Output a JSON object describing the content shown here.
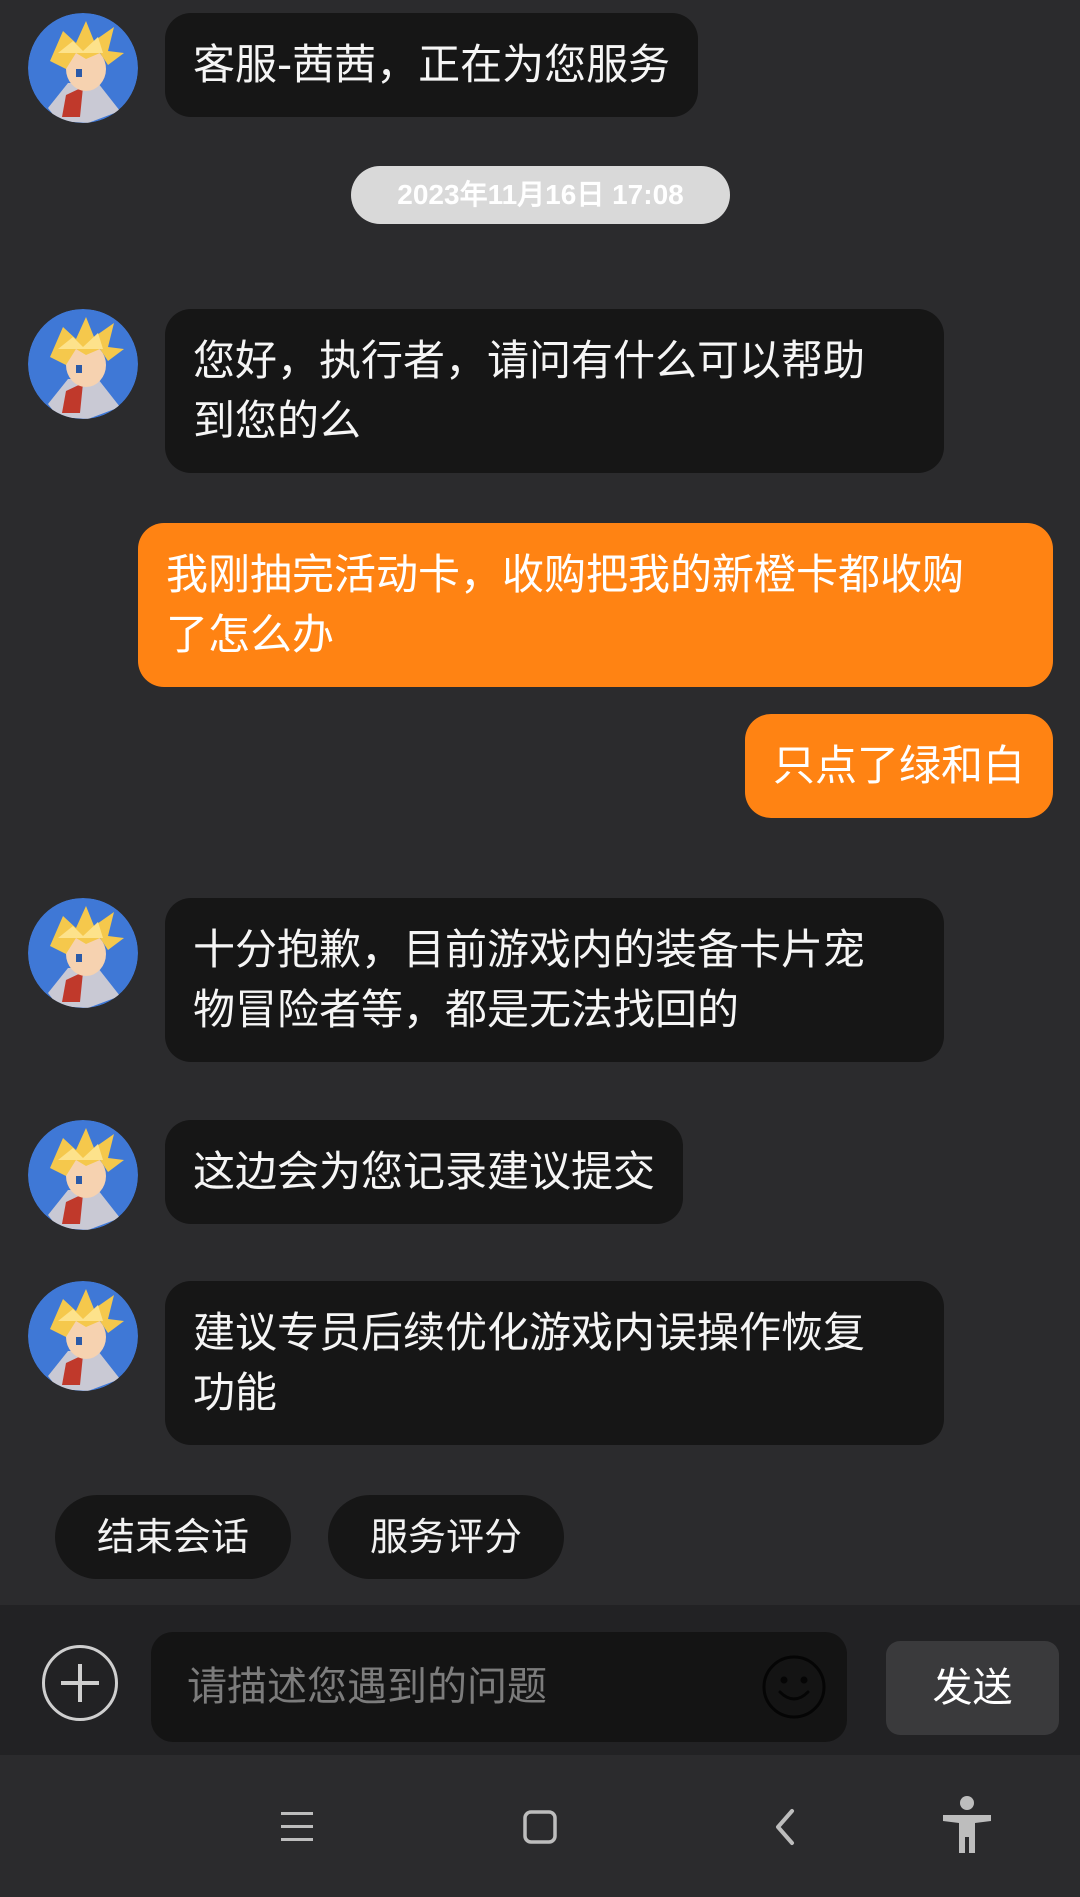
{
  "agent_name": "客服-茜茜",
  "timestamp": "2023年11月16日 17:08",
  "messages": [
    {
      "sender": "agent",
      "text": "客服-茜茜，正在为您服务"
    },
    {
      "sender": "agent",
      "text": "您好，执行者，请问有什么可以帮助\n到您的么"
    },
    {
      "sender": "user",
      "text": "我刚抽完活动卡，收购把我的新橙卡都收购\n了怎么办"
    },
    {
      "sender": "user",
      "text": "只点了绿和白"
    },
    {
      "sender": "agent",
      "text": "十分抱歉，目前游戏内的装备卡片宠\n物冒险者等，都是无法找回的"
    },
    {
      "sender": "agent",
      "text": "这边会为您记录建议提交"
    },
    {
      "sender": "agent",
      "text": "建议专员后续优化游戏内误操作恢复\n功能"
    }
  ],
  "quick_actions": [
    "结束会话",
    "服务评分"
  ],
  "input": {
    "placeholder": "请描述您遇到的问题",
    "send_label": "发送"
  },
  "colors": {
    "background": "#2b2b2d",
    "agent_bubble": "#161616",
    "user_bubble": "#ff8313",
    "timestamp_pill": "#d9d9d9"
  },
  "icons": [
    "plus-circle-icon",
    "smiley-icon",
    "menu-icon",
    "home-square-icon",
    "back-chevron-icon",
    "accessibility-icon"
  ]
}
